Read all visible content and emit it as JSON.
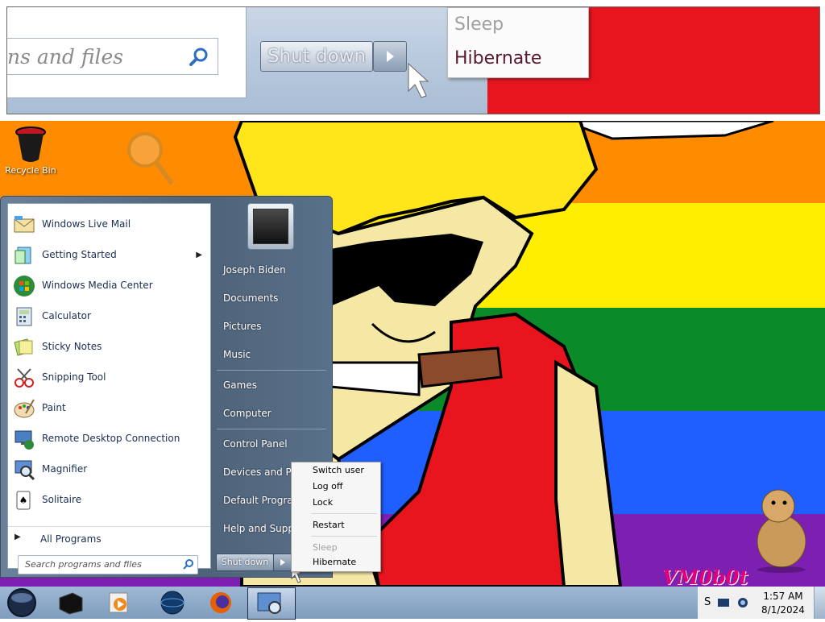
{
  "inset": {
    "search_text": "ns and files",
    "shutdown_label": "Shut down",
    "menu": {
      "sleep": "Sleep",
      "hibernate": "Hibernate"
    }
  },
  "desktop": {
    "icons": [
      {
        "label": "Recycle Bin",
        "icon": "recycle-bin-icon"
      },
      {
        "label": "",
        "icon": "magnifier-icon"
      }
    ],
    "wallpaper_text": "VM0b0t",
    "colors": {
      "orange": "#ff8c00",
      "yellow": "#ffee00",
      "green": "#0b8a2a",
      "blue": "#1f5eff",
      "purple": "#7d1fb0"
    }
  },
  "startmenu": {
    "programs": [
      {
        "label": "Windows Live Mail",
        "icon": "mail-icon",
        "submenu": false
      },
      {
        "label": "Getting Started",
        "icon": "getting-started-icon",
        "submenu": true
      },
      {
        "label": "Windows Media Center",
        "icon": "media-center-icon",
        "submenu": false
      },
      {
        "label": "Calculator",
        "icon": "calculator-icon",
        "submenu": false
      },
      {
        "label": "Sticky Notes",
        "icon": "sticky-notes-icon",
        "submenu": false
      },
      {
        "label": "Snipping Tool",
        "icon": "scissors-icon",
        "submenu": false
      },
      {
        "label": "Paint",
        "icon": "paint-palette-icon",
        "submenu": false
      },
      {
        "label": "Remote Desktop Connection",
        "icon": "remote-desktop-icon",
        "submenu": false
      },
      {
        "label": "Magnifier",
        "icon": "magnifier-icon",
        "submenu": false
      },
      {
        "label": "Solitaire",
        "icon": "cards-icon",
        "submenu": false
      }
    ],
    "all_programs": "All Programs",
    "search_placeholder": "Search programs and files",
    "right_links": [
      "Joseph Biden",
      "Documents",
      "Pictures",
      "Music",
      "Games",
      "Computer",
      "Control Panel",
      "Devices and Prin",
      "Default Program",
      "Help and Suppo"
    ],
    "shutdown_label": "Shut down"
  },
  "submenu": {
    "items": [
      "Switch user",
      "Log off",
      "Lock",
      "Restart",
      "Sleep",
      "Hibernate"
    ]
  },
  "taskbar": {
    "apps": [
      "taskbar-app-black-icon",
      "media-player-icon",
      "globe-icon",
      "firefox-icon",
      "magnifier-window-icon"
    ],
    "tray_letter": "S",
    "time": "1:57 AM",
    "date": "8/1/2024"
  }
}
